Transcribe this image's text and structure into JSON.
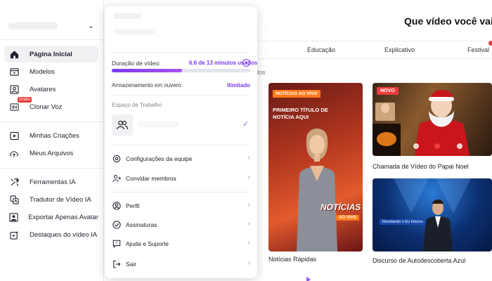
{
  "sidebar": {
    "items": [
      {
        "label": "Página Inicial",
        "icon": "home-icon"
      },
      {
        "label": "Modelos",
        "icon": "templates-icon"
      },
      {
        "label": "Avatares",
        "icon": "avatar-icon"
      },
      {
        "label": "Clonar Voz",
        "icon": "voice-clone-icon",
        "badge": "Grátis"
      },
      {
        "label": "Minhas Criações",
        "icon": "creations-icon"
      },
      {
        "label": "Meus Arquivos",
        "icon": "upload-icon"
      },
      {
        "label": "Ferramentas IA",
        "icon": "tools-icon"
      },
      {
        "label": "Tradutor de Vídeo IA",
        "icon": "translate-icon"
      },
      {
        "label": "Exportar Apenas Avatar",
        "icon": "export-avatar-icon"
      },
      {
        "label": "Destaques do vídeo IA",
        "icon": "highlights-icon"
      }
    ]
  },
  "main": {
    "title": "Que vídeo você vai",
    "tabs": [
      "Educação",
      "Explicativo",
      "Festival"
    ],
    "section_tail": "los",
    "cards": [
      {
        "caption": "Notícias Rápidas",
        "tag_live": "NOTÍCIAS AO VIVO",
        "headline": "PRIMEIRO TÍTULO DE NOTÍCIA AQUI",
        "big_text": "NOTÍCIAS",
        "live_badge": "AO VIVO"
      },
      {
        "caption": "Chamada de Vídeo do Papai Noel",
        "badge": "NOVO"
      },
      {
        "caption": "Discurso de Autodescoberta Azul",
        "banner": "Revelando o Eu Interno"
      }
    ]
  },
  "dropdown": {
    "video_duration_label": "Duração de vídeo:",
    "video_duration_value": "6.6 de 13 minutos usados",
    "video_duration_used_fraction": 0.508,
    "cloud_storage_label": "Armazenamento em nuvem:",
    "cloud_storage_value": "Ilimitado",
    "workspace_label": "Espaço de Trabalho",
    "menu_items": [
      {
        "label": "Configurações da equipe",
        "icon": "settings-icon"
      },
      {
        "label": "Convidar membros",
        "icon": "invite-members-icon"
      },
      {
        "label": "Perfil",
        "icon": "profile-icon"
      },
      {
        "label": "Assinaturas",
        "icon": "subscription-icon"
      },
      {
        "label": "Ajuda e Suporte",
        "icon": "help-icon"
      },
      {
        "label": "Sair",
        "icon": "logout-icon"
      }
    ]
  },
  "colors": {
    "accent": "#7c3aed",
    "badge_red": "#ef3b3b"
  }
}
